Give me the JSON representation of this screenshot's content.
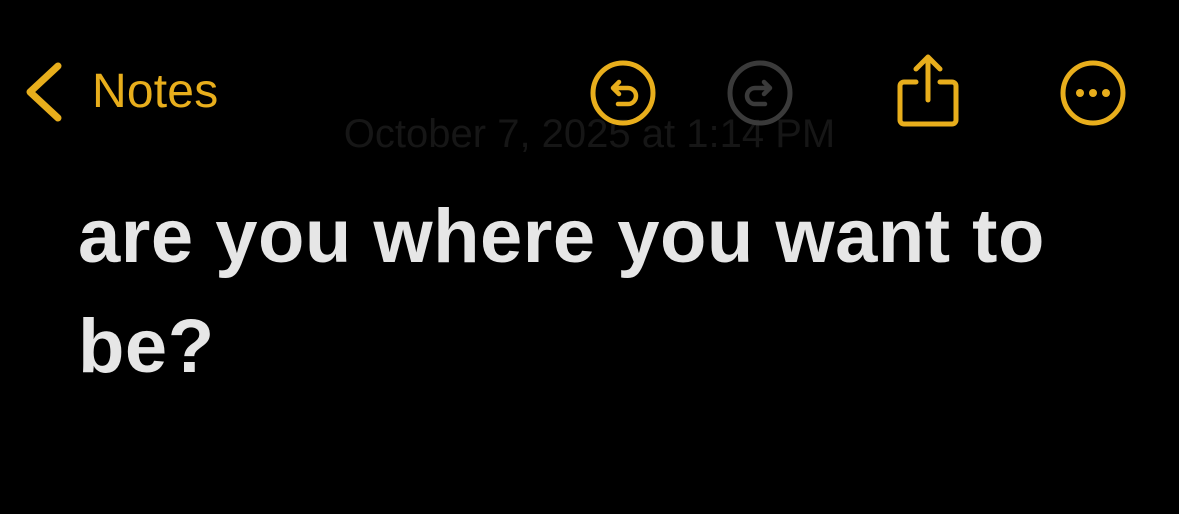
{
  "nav": {
    "back_label": "Notes",
    "icons": {
      "back": "chevron-left-icon",
      "undo": "undo-icon",
      "redo": "redo-icon",
      "share": "share-icon",
      "more": "ellipsis-circle-icon"
    }
  },
  "note": {
    "date": "October 7, 2025 at 1:14 PM",
    "text": "are you where you want to be?"
  },
  "colors": {
    "background": "#000000",
    "accent": "#E8AE1C",
    "disabled_icon": "#3A3A3A",
    "body_text": "#E6E6E6"
  }
}
